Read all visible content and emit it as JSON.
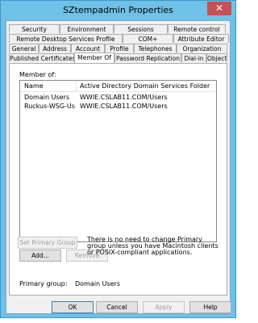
{
  "window": {
    "title": "SZtempadmin Properties",
    "close_glyph": "✕"
  },
  "tabs": {
    "row1": [
      "Security",
      "Environment",
      "Sessions",
      "Remote control"
    ],
    "row2": [
      "Remote Desktop Services Profile",
      "COM+",
      "Attribute Editor"
    ],
    "row3": [
      "General",
      "Address",
      "Account",
      "Profile",
      "Telephones",
      "Organization"
    ],
    "row4": [
      "Published Certificates",
      "Member Of",
      "Password Replication",
      "Dial-in",
      "Object"
    ],
    "active": "Member Of"
  },
  "member_of": {
    "label": "Member of:",
    "columns": [
      "Name",
      "Active Directory Domain Services Folder"
    ],
    "rows": [
      [
        "Domain Users",
        "WWIE.CSLAB11.COM/Users"
      ],
      [
        "Ruckus-WSG-Us...",
        "WWIE.CSLAB11.COM/Users"
      ]
    ],
    "add_label": "Add...",
    "remove_label": "Remove"
  },
  "primary_group": {
    "label": "Primary group:",
    "value": "Domain Users",
    "set_button": "Set Primary Group",
    "note": "There is no need to change Primary group unless you have Macintosh clients or POSIX-compliant applications."
  },
  "dialog_buttons": {
    "ok": "OK",
    "cancel": "Cancel",
    "apply": "Apply",
    "help": "Help"
  },
  "colors": {
    "title_bar": "#6fc1e8",
    "close_button": "#c75050",
    "dialog_bg": "#f0f0f0"
  }
}
